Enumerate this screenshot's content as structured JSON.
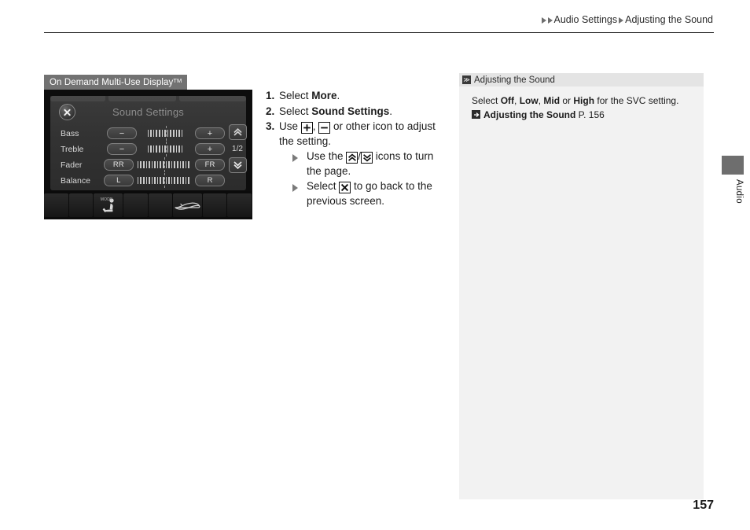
{
  "breadcrumb": {
    "crumb1": "Audio Settings",
    "crumb2": "Adjusting the Sound"
  },
  "left": {
    "caption": "On Demand Multi-Use Display",
    "caption_sup": "TM",
    "screen": {
      "title": "Sound Settings",
      "page_indicator": "1/2",
      "rows": [
        {
          "label": "Bass",
          "left_btn": "−",
          "right_btn": "+",
          "ticks": 13
        },
        {
          "label": "Treble",
          "left_btn": "−",
          "right_btn": "+",
          "ticks": 13
        },
        {
          "label": "Fader",
          "left_btn": "RR",
          "right_btn": "FR",
          "ticks": 19
        },
        {
          "label": "Balance",
          "left_btn": "L",
          "right_btn": "R",
          "ticks": 19
        }
      ],
      "mode_key_text": "MODE"
    }
  },
  "steps": {
    "step1": {
      "num": "1.",
      "pre": "Select ",
      "bold": "More",
      "post": "."
    },
    "step2": {
      "num": "2.",
      "pre": "Select ",
      "bold": "Sound Settings",
      "post": "."
    },
    "step3": {
      "num": "3.",
      "pre": "Use ",
      "mid": ", ",
      "post": " or other icon to adjust the setting."
    },
    "sub1": {
      "pre": "Use the ",
      "mid": "/",
      "post": " icons to turn the page."
    },
    "sub2": {
      "pre": "Select ",
      "post": " to go back to the previous screen."
    }
  },
  "info_panel": {
    "head_glyph": "≫",
    "head_title": "Adjusting the Sound",
    "body_pre": "Select ",
    "opt1": "Off",
    "sep1": ", ",
    "opt2": "Low",
    "sep2": ", ",
    "opt3": "Mid",
    "sep3": " or ",
    "opt4": "High",
    "body_post": " for the SVC setting.",
    "ref_title": "Adjusting the Sound",
    "ref_page": "P. 156"
  },
  "side_tab": {
    "label": "Audio"
  },
  "page_number": "157"
}
